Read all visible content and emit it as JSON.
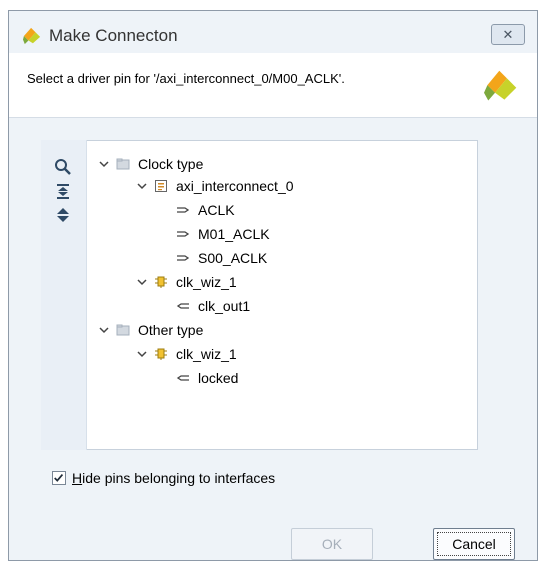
{
  "window": {
    "title": "Make Connecton",
    "close_glyph": "✕"
  },
  "header": {
    "text": "Select a driver pin for '/axi_interconnect_0/M00_ACLK'."
  },
  "toolbar": {
    "tools": [
      {
        "name": "search-icon"
      },
      {
        "name": "collapse-all-icon"
      },
      {
        "name": "expand-all-icon"
      }
    ]
  },
  "tree": {
    "rows": [
      {
        "label": "Clock type",
        "icon": "folder-icon",
        "expanded": true
      },
      {
        "label": "axi_interconnect_0",
        "icon": "ip-block-icon",
        "expanded": true
      },
      {
        "label": "ACLK",
        "icon": "input-pin-icon"
      },
      {
        "label": "M01_ACLK",
        "icon": "input-pin-icon"
      },
      {
        "label": "S00_ACLK",
        "icon": "input-pin-icon"
      },
      {
        "label": "clk_wiz_1",
        "icon": "clock-wizard-icon",
        "expanded": true
      },
      {
        "label": "clk_out1",
        "icon": "output-pin-icon"
      },
      {
        "label": "Other type",
        "icon": "folder-icon",
        "expanded": true
      },
      {
        "label": "clk_wiz_1",
        "icon": "clock-wizard-icon",
        "expanded": true
      },
      {
        "label": "locked",
        "icon": "output-pin-icon"
      }
    ]
  },
  "options": {
    "hide_pins_label_first": "H",
    "hide_pins_label_rest": "ide pins belonging to interfaces",
    "hide_pins_checked": true
  },
  "buttons": {
    "ok": "OK",
    "cancel": "Cancel"
  },
  "colors": {
    "accent": "#f3a51a",
    "logo_green": "#c7d22a"
  }
}
